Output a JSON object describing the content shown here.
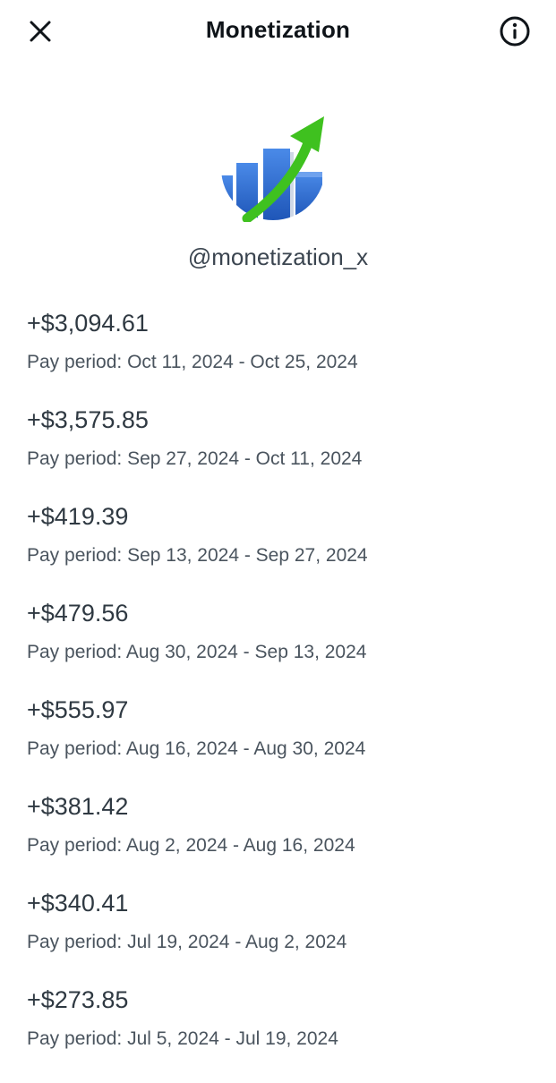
{
  "header": {
    "title": "Monetization",
    "close_icon": "close-icon",
    "info_icon": "info-icon"
  },
  "profile": {
    "handle": "@monetization_x",
    "logo_icon": "growth-chart-logo",
    "colors": {
      "bars": "#2d6fd6",
      "arrow": "#3fc11f"
    }
  },
  "payouts": [
    {
      "amount": "+$3,094.61",
      "period": "Pay period: Oct 11, 2024 - Oct 25, 2024"
    },
    {
      "amount": "+$3,575.85",
      "period": "Pay period: Sep 27, 2024 - Oct 11, 2024"
    },
    {
      "amount": "+$419.39",
      "period": "Pay period: Sep 13, 2024 - Sep 27, 2024"
    },
    {
      "amount": "+$479.56",
      "period": "Pay period: Aug 30, 2024 - Sep 13, 2024"
    },
    {
      "amount": "+$555.97",
      "period": "Pay period: Aug 16, 2024 - Aug 30, 2024"
    },
    {
      "amount": "+$381.42",
      "period": "Pay period: Aug 2, 2024 - Aug 16, 2024"
    },
    {
      "amount": "+$340.41",
      "period": "Pay period: Jul 19, 2024 - Aug 2, 2024"
    },
    {
      "amount": "+$273.85",
      "period": "Pay period: Jul 5, 2024 - Jul 19, 2024"
    }
  ]
}
